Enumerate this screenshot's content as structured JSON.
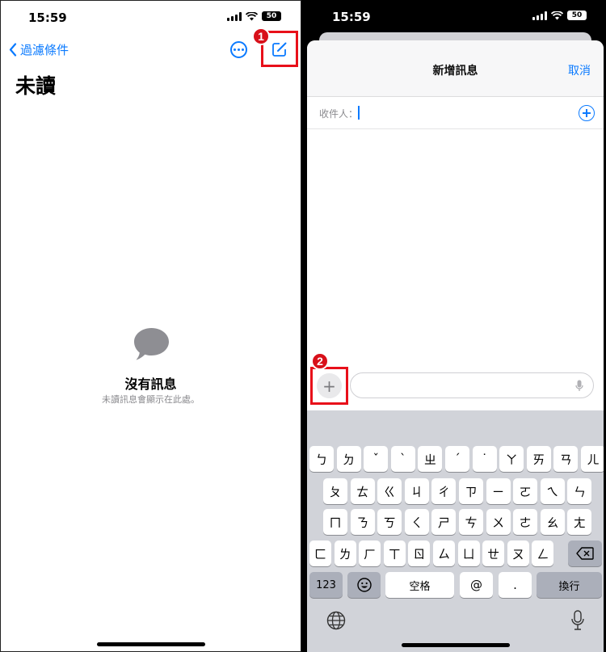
{
  "left": {
    "status": {
      "time": "15:59",
      "battery": "50"
    },
    "nav": {
      "back_label": "過濾條件"
    },
    "step1": "1",
    "title": "未讀",
    "empty": {
      "title": "沒有訊息",
      "subtitle": "未讀訊息會顯示在此處。"
    }
  },
  "right": {
    "status": {
      "time": "15:59",
      "battery": "50"
    },
    "sheet": {
      "title": "新增訊息",
      "cancel": "取消",
      "to_label": "收件人："
    },
    "step2": "2",
    "plus_label": "+",
    "keyboard": {
      "row1": [
        "ㄅ",
        "ㄉ",
        "ˇ",
        "ˋ",
        "ㄓ",
        "ˊ",
        "˙",
        "ㄚ",
        "ㄞ",
        "ㄢ",
        "ㄦ"
      ],
      "row2": [
        "ㄆ",
        "ㄊ",
        "ㄍ",
        "ㄐ",
        "ㄔ",
        "ㄗ",
        "ㄧ",
        "ㄛ",
        "ㄟ",
        "ㄣ"
      ],
      "row3": [
        "ㄇ",
        "ㄋ",
        "ㄎ",
        "ㄑ",
        "ㄕ",
        "ㄘ",
        "ㄨ",
        "ㄜ",
        "ㄠ",
        "ㄤ"
      ],
      "row4": [
        "ㄈ",
        "ㄌ",
        "ㄏ",
        "ㄒ",
        "ㄖ",
        "ㄙ",
        "ㄩ",
        "ㄝ",
        "ㄡ",
        "ㄥ"
      ],
      "num_key": "123",
      "space_key": "空格",
      "at_key": "@",
      "dot_key": ".",
      "return_key": "換行"
    }
  },
  "icons": [
    "chevron-left-icon",
    "more-icon",
    "compose-icon",
    "chat-bubble-icon",
    "add-contact-icon",
    "microphone-icon",
    "emoji-icon",
    "delete-icon",
    "globe-icon",
    "dictation-icon"
  ],
  "colors": {
    "accent": "#0a7aff",
    "highlight": "#e8101a"
  }
}
